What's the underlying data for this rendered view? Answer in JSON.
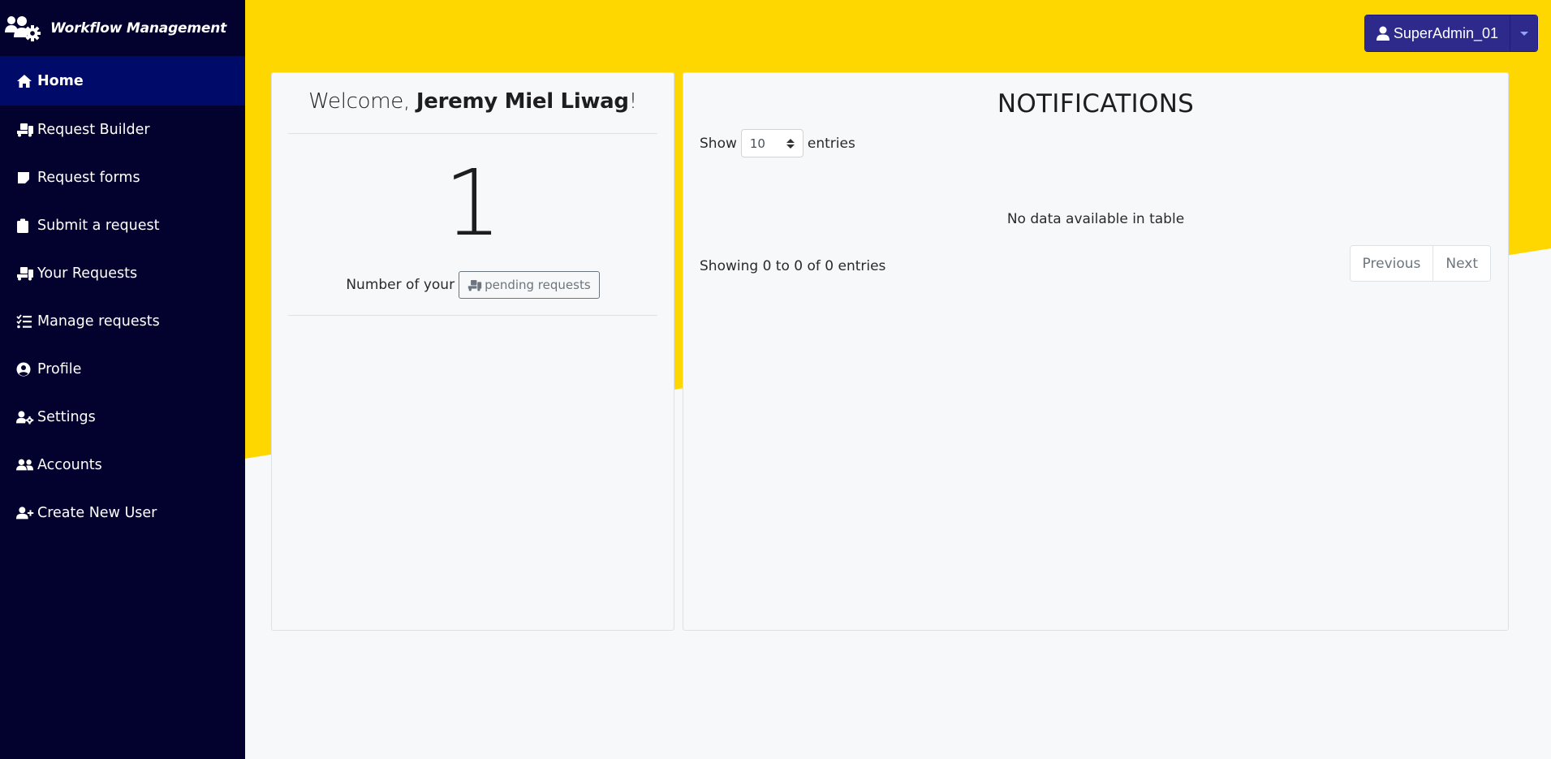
{
  "app": {
    "title": "Workflow Management",
    "logo_icon": "users-gear-icon"
  },
  "sidebar": {
    "items": [
      {
        "label": "Home",
        "icon": "home-icon",
        "active": true
      },
      {
        "label": "Request Builder",
        "icon": "truck-ramp-box-icon",
        "active": false
      },
      {
        "label": "Request forms",
        "icon": "sticky-note-icon",
        "active": false
      },
      {
        "label": "Submit a request",
        "icon": "clipboard-icon",
        "active": false
      },
      {
        "label": "Your Requests",
        "icon": "truck-ramp-box-icon",
        "active": false
      },
      {
        "label": "Manage requests",
        "icon": "list-check-icon",
        "active": false
      },
      {
        "label": "Profile",
        "icon": "user-circle-icon",
        "active": false
      },
      {
        "label": "Settings",
        "icon": "user-gear-icon",
        "active": false
      },
      {
        "label": "Accounts",
        "icon": "user-group-icon",
        "active": false
      },
      {
        "label": "Create New User",
        "icon": "user-plus-icon",
        "active": false
      }
    ]
  },
  "user_menu": {
    "label": "SuperAdmin_01",
    "icon": "user-icon"
  },
  "welcome": {
    "prefix": "Welcome, ",
    "name": "Jeremy Miel Liwag",
    "suffix": "!",
    "pending_count": "1",
    "pending_prefix": "Number of your",
    "pending_button": "pending requests"
  },
  "notifications": {
    "title": "NOTIFICATIONS",
    "show_label": "Show",
    "entries_label": "entries",
    "page_length": "10",
    "empty_message": "No data available in table",
    "info": "Showing 0 to 0 of 0 entries",
    "previous_label": "Previous",
    "next_label": "Next"
  },
  "colors": {
    "sidebar_bg": "#03022f",
    "sidebar_active": "#000b69",
    "accent_yellow": "#ffd700",
    "user_button": "#2d2a8c"
  }
}
